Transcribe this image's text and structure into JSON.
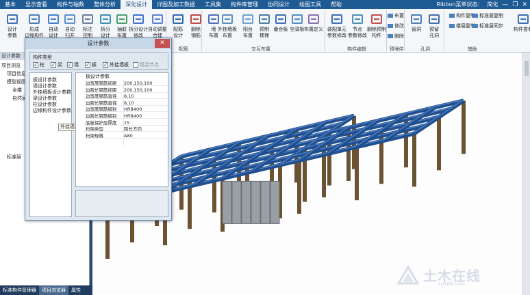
{
  "menubar": {
    "items": [
      "基本",
      "显示查看",
      "构件与轴数",
      "整体分析",
      "深化设计",
      "详图及加工数据",
      "工具集",
      "构件库管理",
      "协同设计",
      "绘图工具",
      "帮助"
    ],
    "active_index": 4,
    "right_label": "Ribbon菜单状态：",
    "right_value": "简化"
  },
  "ribbon": {
    "buttons": [
      {
        "label": "设计\n参数",
        "icon": "settings-icon"
      },
      {
        "label": "形成\n边缘构件",
        "icon": "edge-member-icon"
      },
      {
        "label": "自动\n设计",
        "icon": "auto-design-icon"
      },
      {
        "label": "自动\n归并",
        "icon": "auto-merge-icon"
      },
      {
        "label": "标注\n控制",
        "icon": "annotation-icon"
      },
      {
        "label": "拆分\n设计",
        "icon": "split-design-icon"
      },
      {
        "label": "抽取\n布置",
        "icon": "extract-layout-icon"
      },
      {
        "label": "拆分设计\n修改",
        "icon": "split-edit-icon"
      },
      {
        "label": "自动调整\n合建",
        "icon": "auto-adjust-icon"
      },
      {
        "label": "配筋\n设计",
        "icon": "rebar-design-icon"
      },
      {
        "label": "删除\n钢筋",
        "icon": "delete-rebar-icon"
      },
      {
        "label": "墙\n布置",
        "icon": "wall-icon"
      },
      {
        "label": "外挂墙板\n布置",
        "icon": "cladding-panel-icon"
      },
      {
        "label": "阳台\n布置",
        "icon": "balcony-icon"
      },
      {
        "label": "预制\n楼梯",
        "icon": "stair-icon"
      },
      {
        "label": "叠合板",
        "icon": "composite-slab-icon"
      },
      {
        "label": "空调板",
        "icon": "ac-slab-icon"
      },
      {
        "label": "布置定义",
        "icon": "layout-define-icon"
      },
      {
        "label": "装配单元\n参数修改",
        "icon": "assembly-unit-icon"
      },
      {
        "label": "节点\n参数修改",
        "icon": "node-param-icon"
      },
      {
        "label": "删除预制\n构件",
        "icon": "delete-precast-icon"
      },
      {
        "label": "窗洞",
        "icon": "window-opening-icon"
      },
      {
        "label": "预留\n孔洞",
        "icon": "reserved-hole-icon"
      },
      {
        "label": "构件查看",
        "icon": "component-view-icon"
      }
    ],
    "small_items": [
      {
        "label": "布置",
        "icon": "layout-small-icon"
      },
      {
        "label": "修改",
        "icon": "edit-small-icon"
      },
      {
        "label": "删除",
        "icon": "delete-small-icon"
      },
      {
        "label": "构件复制",
        "icon": "component-copy-icon"
      },
      {
        "label": "标准层复制",
        "icon": "floor-copy-icon"
      },
      {
        "label": "楼层复制",
        "icon": "level-copy-icon"
      },
      {
        "label": "标准层同步",
        "icon": "floor-sync-icon"
      }
    ],
    "groups": [
      "配筋",
      "交互布置",
      "构件编辑",
      "预埋件",
      "孔洞",
      "辅助"
    ]
  },
  "left_panel": {
    "title": "设计参数",
    "rows": [
      "项目浏览",
      "项目信息",
      "模型视图",
      "全楼",
      "自然层",
      "标准层"
    ]
  },
  "bottom_tabs": [
    "标准构件管理器",
    "项目浏览器",
    "属性"
  ],
  "bottom_tab_active": 1,
  "dialog": {
    "title": "设计参数",
    "close": "✕",
    "types_caption": "构件类型",
    "checkboxes": [
      {
        "label": "柱",
        "checked": true,
        "enabled": true
      },
      {
        "label": "梁",
        "checked": true,
        "enabled": true
      },
      {
        "label": "墙",
        "checked": true,
        "enabled": true
      },
      {
        "label": "板",
        "checked": true,
        "enabled": true
      },
      {
        "label": "外挂墙板",
        "checked": true,
        "enabled": true
      },
      {
        "label": "现浇节点",
        "checked": false,
        "enabled": false
      }
    ],
    "list_items": [
      "板设计参数",
      "墙设计参数",
      "外挂墙板设计参数",
      "梁设计参数",
      "柱设计参数",
      "边缘构件设计参数"
    ],
    "tooltip": "外挂墙板设计参数",
    "prop_header": "板设计参数",
    "properties": [
      {
        "key": "边宽度钢筋间距",
        "value": "200,150,100"
      },
      {
        "key": "边跨长钢筋间距",
        "value": "200,150,100"
      },
      {
        "key": "边宽度钢筋直径",
        "value": "8,10"
      },
      {
        "key": "边跨长钢筋直径",
        "value": "8,10"
      },
      {
        "key": "边宽度钢筋级别",
        "value": "HRB400"
      },
      {
        "key": "边跨长钢筋级别",
        "value": "HRB400"
      },
      {
        "key": "底板保护层厚度",
        "value": "15"
      },
      {
        "key": "桁架类型",
        "value": "跨长方向"
      },
      {
        "key": "桁架规格",
        "value": "A80"
      }
    ]
  },
  "watermark": {
    "text": "土木在线",
    "url": "co188.com"
  },
  "colors": {
    "menubar": "#1e5a94",
    "beam": "#1f4f8f",
    "column": "#6b5232",
    "wall_panel": "#9a9ea5"
  }
}
